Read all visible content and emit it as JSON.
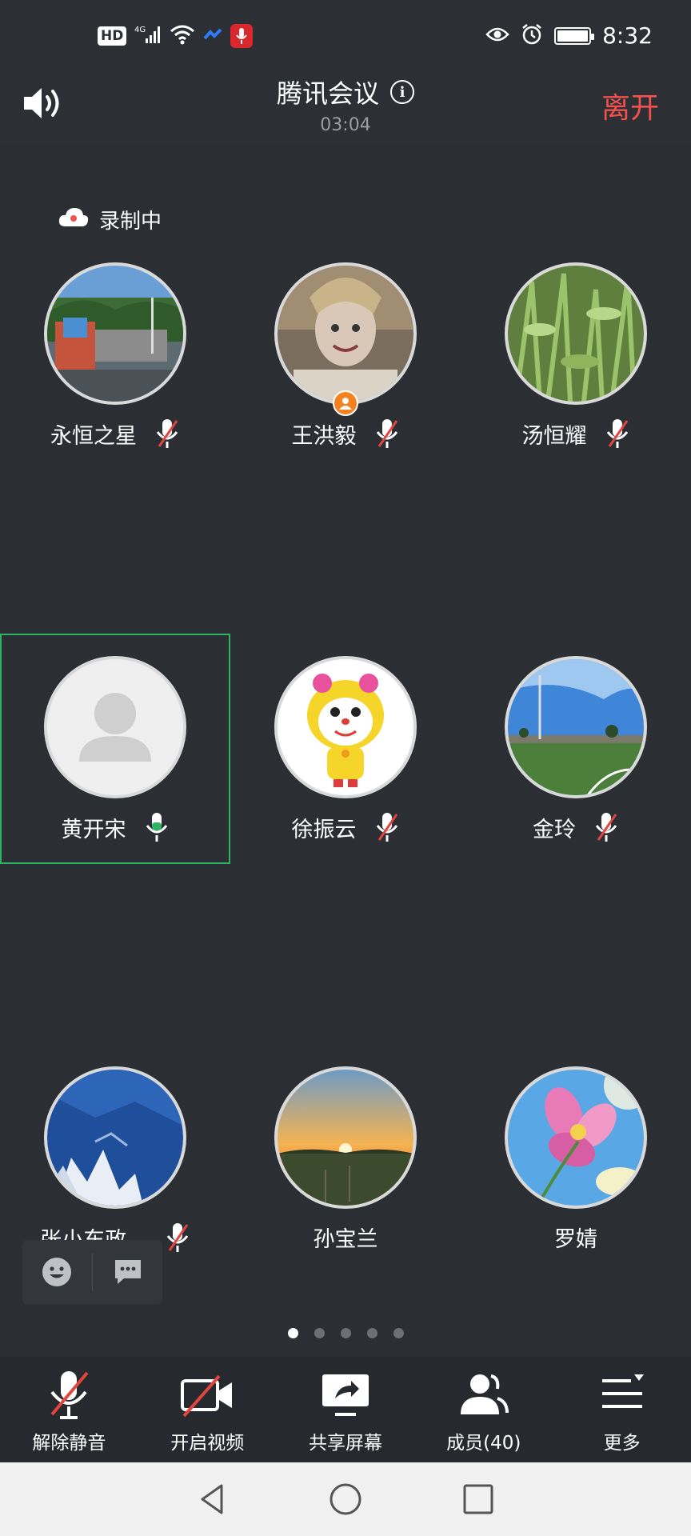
{
  "status_bar": {
    "hd": "HD",
    "signal": "4G",
    "time": "8:32"
  },
  "header": {
    "title": "腾讯会议",
    "timer": "03:04",
    "leave_label": "离开"
  },
  "recording_label": "录制中",
  "participants": [
    {
      "name": "永恒之星",
      "mic": "muted"
    },
    {
      "name": "王洪毅",
      "mic": "muted",
      "host": true
    },
    {
      "name": "汤恒耀",
      "mic": "muted"
    },
    {
      "name": "黄开宋",
      "mic": "on",
      "active": true
    },
    {
      "name": "徐振云",
      "mic": "muted"
    },
    {
      "name": "金玲",
      "mic": "muted"
    },
    {
      "name": "张小东政...",
      "mic": "muted"
    },
    {
      "name": "孙宝兰",
      "mic": "none"
    },
    {
      "name": "罗婧",
      "mic": "none"
    }
  ],
  "pagination": {
    "pages": 5,
    "current": 1
  },
  "toolbar": {
    "unmute_label": "解除静音",
    "video_label": "开启视频",
    "share_label": "共享屏幕",
    "members_label": "成员(40)",
    "more_label": "更多"
  },
  "colors": {
    "background": "#2b2e33",
    "leave": "#f2514e",
    "active_border": "#2fb463",
    "mic_on": "#2fb463",
    "mute_slash": "#e0453f",
    "host_badge": "#f5821f"
  }
}
